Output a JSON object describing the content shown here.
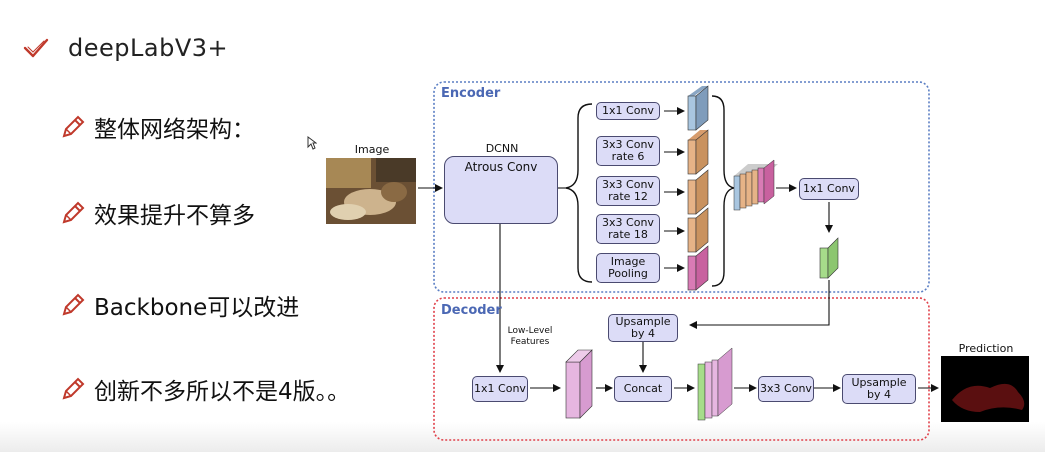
{
  "slide": {
    "title": "deepLabV3+",
    "bullets": [
      {
        "text": "整体网络架构："
      },
      {
        "text": "效果提升不算多"
      },
      {
        "text": "Backbone可以改进"
      },
      {
        "text": "创新不多所以不是4版。。"
      }
    ]
  },
  "diagram": {
    "encoder_label": "Encoder",
    "decoder_label": "Decoder",
    "image_label": "Image",
    "dcnn_label": "DCNN",
    "atrous_label": "Atrous Conv",
    "aspp": {
      "conv1x1": "1x1 Conv",
      "conv3_r6": "3x3 Conv\nrate 6",
      "conv3_r12": "3x3 Conv\nrate 12",
      "conv3_r18": "3x3 Conv\nrate 18",
      "pooling": "Image\nPooling"
    },
    "encoder_out_conv": "1x1 Conv",
    "low_level_label": "Low-Level\nFeatures",
    "decoder_conv1x1": "1x1 Conv",
    "upsample1": "Upsample\nby 4",
    "concat": "Concat",
    "conv3x3": "3x3 Conv",
    "upsample2": "Upsample\nby 4",
    "prediction_label": "Prediction",
    "colors": {
      "encoder_border": "#5b7fc4",
      "decoder_border": "#e0404a",
      "box_fill": "#dcdcf7",
      "feat_blue": "#a9c6e0",
      "feat_orange": "#e6b387",
      "feat_pink": "#d97bb5",
      "feat_green": "#a6dc8a",
      "feat_lilac": "#e6b6e0"
    }
  }
}
